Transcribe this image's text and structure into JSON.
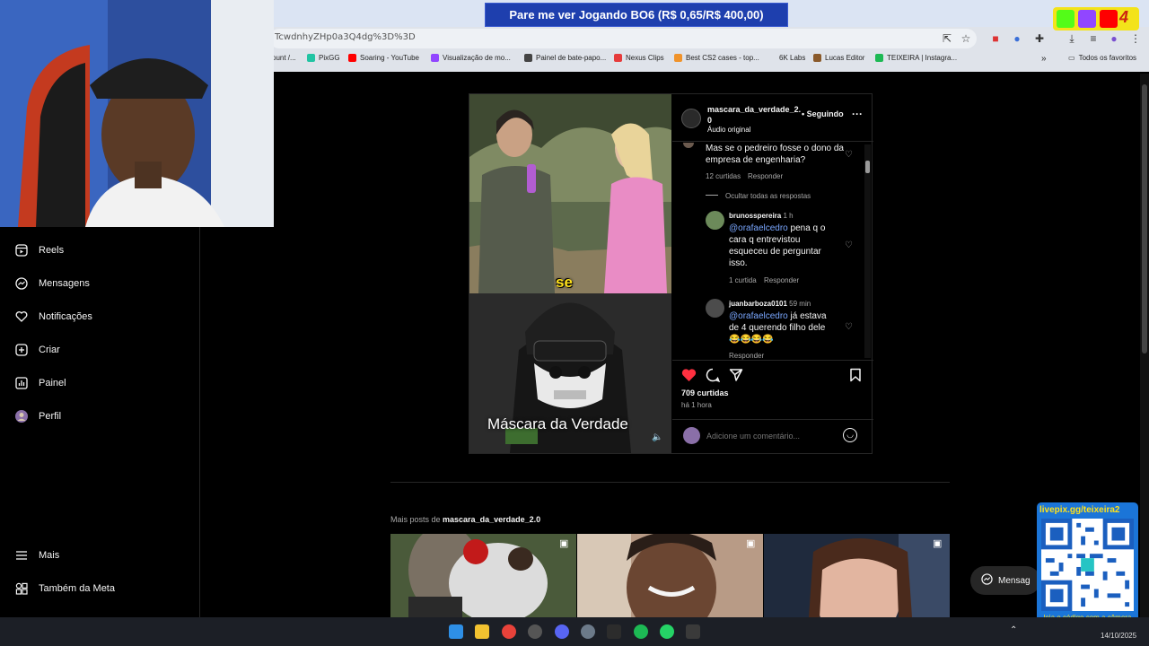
{
  "browser": {
    "url": "TcwdnhyZHp0a3Q4dg%3D%3D",
    "bookmarks": [
      {
        "label": "ount /...",
        "color": "#888888"
      },
      {
        "label": "PixGG",
        "color": "#21c4a3"
      },
      {
        "label": "Soaring - YouTube",
        "color": "#ff0000"
      },
      {
        "label": "Visualização de mo...",
        "color": "#9146ff"
      },
      {
        "label": "Painel de bate-papo...",
        "color": "#444444"
      },
      {
        "label": "Nexus Clips",
        "color": "#e63b3b"
      },
      {
        "label": "Best CS2 cases - top...",
        "color": "#f0932b"
      },
      {
        "label": "6K Labs",
        "color": "#cccccc"
      },
      {
        "label": "Lucas Editor",
        "color": "#8a5a2b"
      },
      {
        "label": "TEIXEIRA | Instagra...",
        "color": "#1db954"
      }
    ],
    "all_bookmarks": "Todos os favoritos"
  },
  "stream_banner": "Pare me ver Jogando BO6 (R$ 0,65/R$ 400,00)",
  "stream_badge_count": "4",
  "sidebar": {
    "items": [
      {
        "label": "Reels",
        "icon": "reels-icon"
      },
      {
        "label": "Mensagens",
        "icon": "messenger-icon"
      },
      {
        "label": "Notificações",
        "icon": "heart-icon"
      },
      {
        "label": "Criar",
        "icon": "plus-square-icon"
      },
      {
        "label": "Painel",
        "icon": "chart-icon"
      },
      {
        "label": "Perfil",
        "icon": "avatar"
      }
    ],
    "more": "Mais",
    "meta": "Também da Meta"
  },
  "post": {
    "video_caption_word": "se",
    "video_title": "Máscara da Verdade",
    "username_line1": "mascara_da_verdade_2.",
    "username_line2": "0",
    "following": "Seguindo",
    "audio": "Áudio original",
    "comments": {
      "top": {
        "text": "Mas se o pedreiro fosse o dono da empresa de engenharia?",
        "likes": "12 curtidas",
        "reply": "Responder",
        "hide_replies": "Ocultar todas as respostas"
      },
      "replies": [
        {
          "user": "brunosspereira",
          "time": "1 h",
          "mention": "@orafaelcedro",
          "text": " pena q o cara q entrevistou esqueceu de perguntar isso.",
          "likes": "1 curtida",
          "reply": "Responder"
        },
        {
          "user": "juanbarboza0101",
          "time": "59 min",
          "mention": "@orafaelcedro",
          "text": " já estava de 4 querendo filho dele 😂😂😂😂",
          "reply": "Responder"
        }
      ]
    },
    "likes": "709 curtidas",
    "posted": "há 1 hora",
    "comment_placeholder": "Adicione um comentário..."
  },
  "more_posts": {
    "prefix": "Mais posts de ",
    "user": "mascara_da_verdade_2.0"
  },
  "messages_button": "Mensag",
  "qr": {
    "title": "livepix.gg/teixeira2",
    "caption": "leia o código com a câmera do celular.",
    "date": "14/10/2025"
  }
}
